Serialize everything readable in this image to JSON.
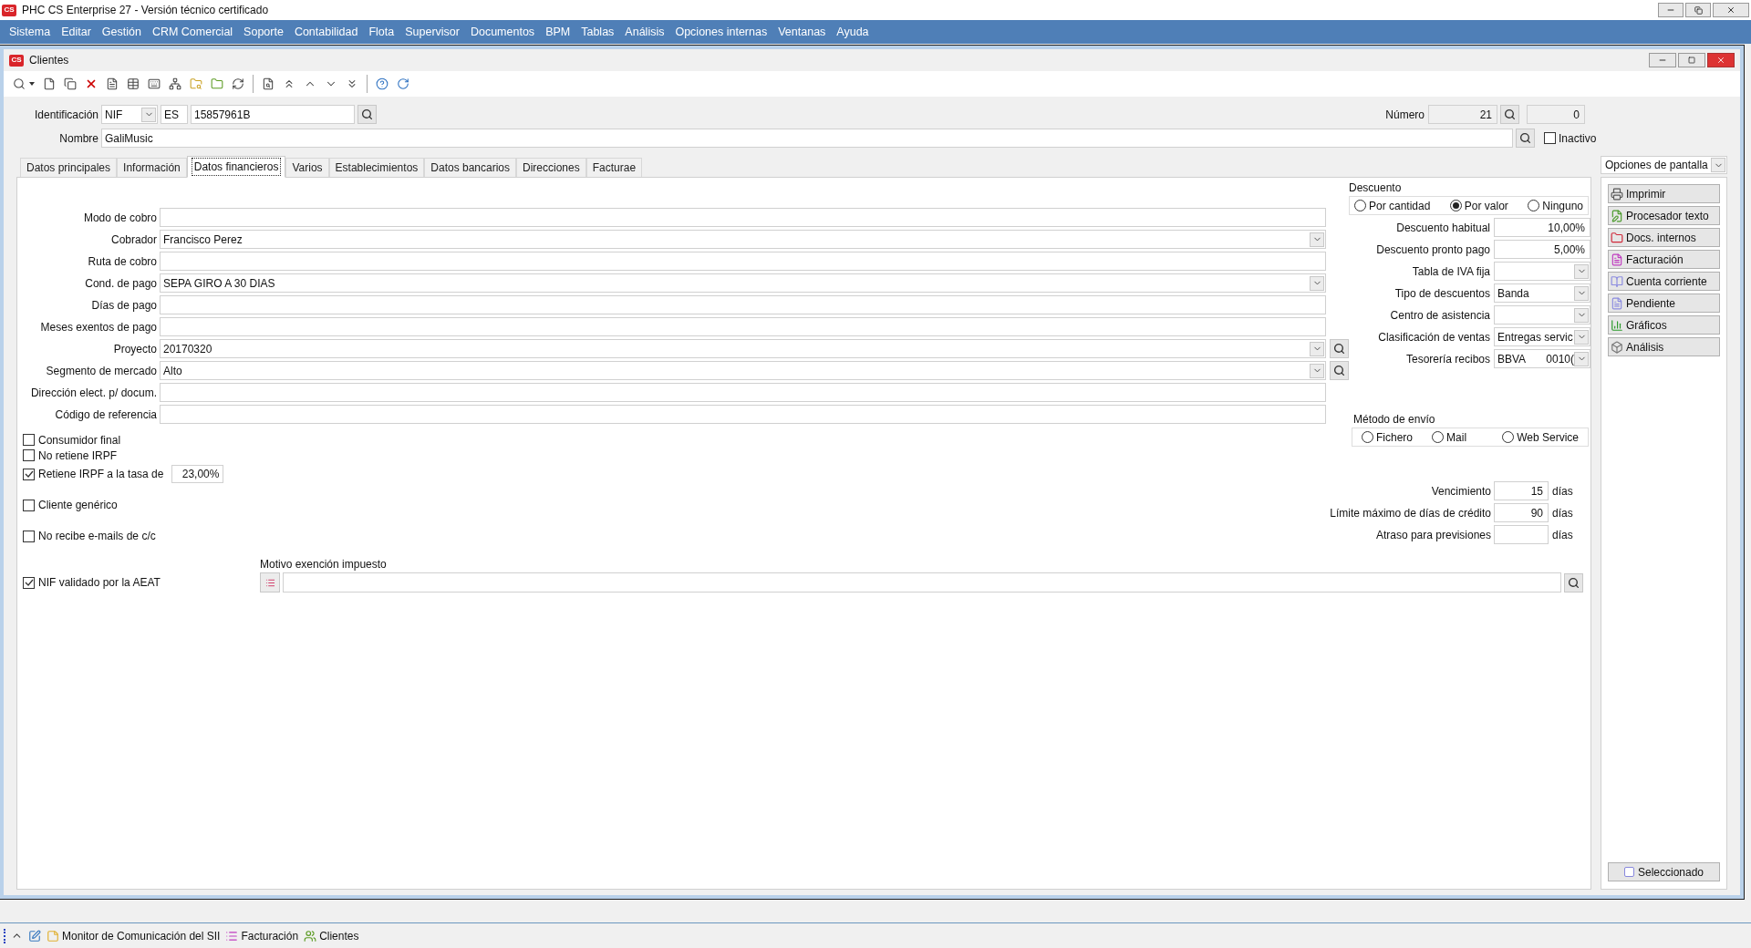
{
  "app": {
    "logo": "CS",
    "title": "PHC CS Enterprise 27 - Versión técnico certificado"
  },
  "menu": [
    "Sistema",
    "Editar",
    "Gestión",
    "CRM Comercial",
    "Soporte",
    "Contabilidad",
    "Flota",
    "Supervisor",
    "Documentos",
    "BPM",
    "Tablas",
    "Análisis",
    "Opciones internas",
    "Ventanas",
    "Ayuda"
  ],
  "window": {
    "logo": "CS",
    "title": "Clientes"
  },
  "header": {
    "id_label": "Identificación",
    "id_type": "NIF",
    "country": "ES",
    "nif": "15857961B",
    "number_label": "Número",
    "number": "21",
    "number_extra": "0",
    "name_label": "Nombre",
    "name": "GaliMusic",
    "inactive": {
      "label": "Inactivo",
      "checked": false
    }
  },
  "tabs": [
    {
      "label": "Datos principales",
      "selected": false
    },
    {
      "label": "Información",
      "selected": false
    },
    {
      "label": "Datos financieros",
      "selected": true
    },
    {
      "label": "Varios",
      "selected": false
    },
    {
      "label": "Establecimientos",
      "selected": false
    },
    {
      "label": "Datos bancarios",
      "selected": false
    },
    {
      "label": "Direcciones",
      "selected": false
    },
    {
      "label": "Facturae",
      "selected": false
    }
  ],
  "fields": [
    {
      "label": "Modo de cobro",
      "kind": "text"
    },
    {
      "label": "Cobrador",
      "value": "Francisco Perez",
      "kind": "combo"
    },
    {
      "label": "Ruta de cobro",
      "kind": "text"
    },
    {
      "label": "Cond. de pago",
      "value": "SEPA GIRO A 30 DIAS",
      "kind": "combo"
    },
    {
      "label": "Días de pago",
      "kind": "text"
    },
    {
      "label": "Meses exentos de pago",
      "kind": "text"
    },
    {
      "label": "Proyecto",
      "value": "20170320",
      "kind": "combo_search"
    },
    {
      "label": "Segmento de mercado",
      "value": "Alto",
      "kind": "combo_search"
    },
    {
      "label": "Dirección elect. p/ docum.",
      "kind": "text"
    },
    {
      "label": "Código de referencia",
      "kind": "text"
    }
  ],
  "checkboxes": [
    {
      "label": "Consumidor final",
      "checked": false
    },
    {
      "label": "No retiene IRPF",
      "checked": false
    },
    {
      "label": "Retiene IRPF a la tasa de",
      "checked": true,
      "rate": "23,00%"
    },
    {
      "label": "Cliente genérico",
      "checked": false
    },
    {
      "label": "No recibe e-mails de c/c",
      "checked": false
    }
  ],
  "aeat": {
    "label": "NIF validado por la AEAT",
    "checked": true
  },
  "tax_exemption": {
    "label": "Motivo exención impuesto"
  },
  "discount": {
    "label": "Descuento",
    "options": [
      {
        "label": "Por cantidad",
        "selected": false
      },
      {
        "label": "Por valor",
        "selected": true
      },
      {
        "label": "Ninguno",
        "selected": false
      }
    ]
  },
  "discount_fields": [
    {
      "label": "Descuento habitual",
      "value": "10,00%",
      "kind": "number"
    },
    {
      "label": "Descuento pronto pago",
      "value": "5,00%",
      "kind": "number"
    },
    {
      "label": "Tabla de IVA fija",
      "kind": "combo"
    },
    {
      "label": "Tipo de descuentos",
      "value": "Banda",
      "kind": "combo"
    },
    {
      "label": "Centro de asistencia",
      "kind": "combo"
    },
    {
      "label": "Clasificación de ventas",
      "value": "Entregas servic",
      "kind": "combo"
    },
    {
      "label": "Tesorería recibos",
      "value": "BBVA",
      "value_2": "0010(",
      "kind": "combo"
    }
  ],
  "shipping": {
    "label": "Método de envío",
    "options": [
      {
        "label": "Fichero",
        "selected": false
      },
      {
        "label": "Mail",
        "selected": false
      },
      {
        "label": "Web Service",
        "selected": false
      }
    ]
  },
  "terms": [
    {
      "label": "Vencimiento",
      "value": "15",
      "unit": "días"
    },
    {
      "label": "Límite máximo de días de crédito",
      "value": "90",
      "unit": "días"
    },
    {
      "label": "Atraso para previsiones",
      "unit": "días"
    }
  ],
  "screen_options": {
    "label": "Opciones de pantalla",
    "buttons": [
      "Imprimir",
      "Procesador texto",
      "Docs. internos",
      "Facturación",
      "Cuenta corriente",
      "Pendiente",
      "Gráficos",
      "Análisis"
    ],
    "selected_toggle": {
      "label": "Seleccionado",
      "checked": false
    }
  },
  "taskbar": [
    "Monitor de Comunicación del SII",
    "Facturación",
    "Clientes"
  ]
}
